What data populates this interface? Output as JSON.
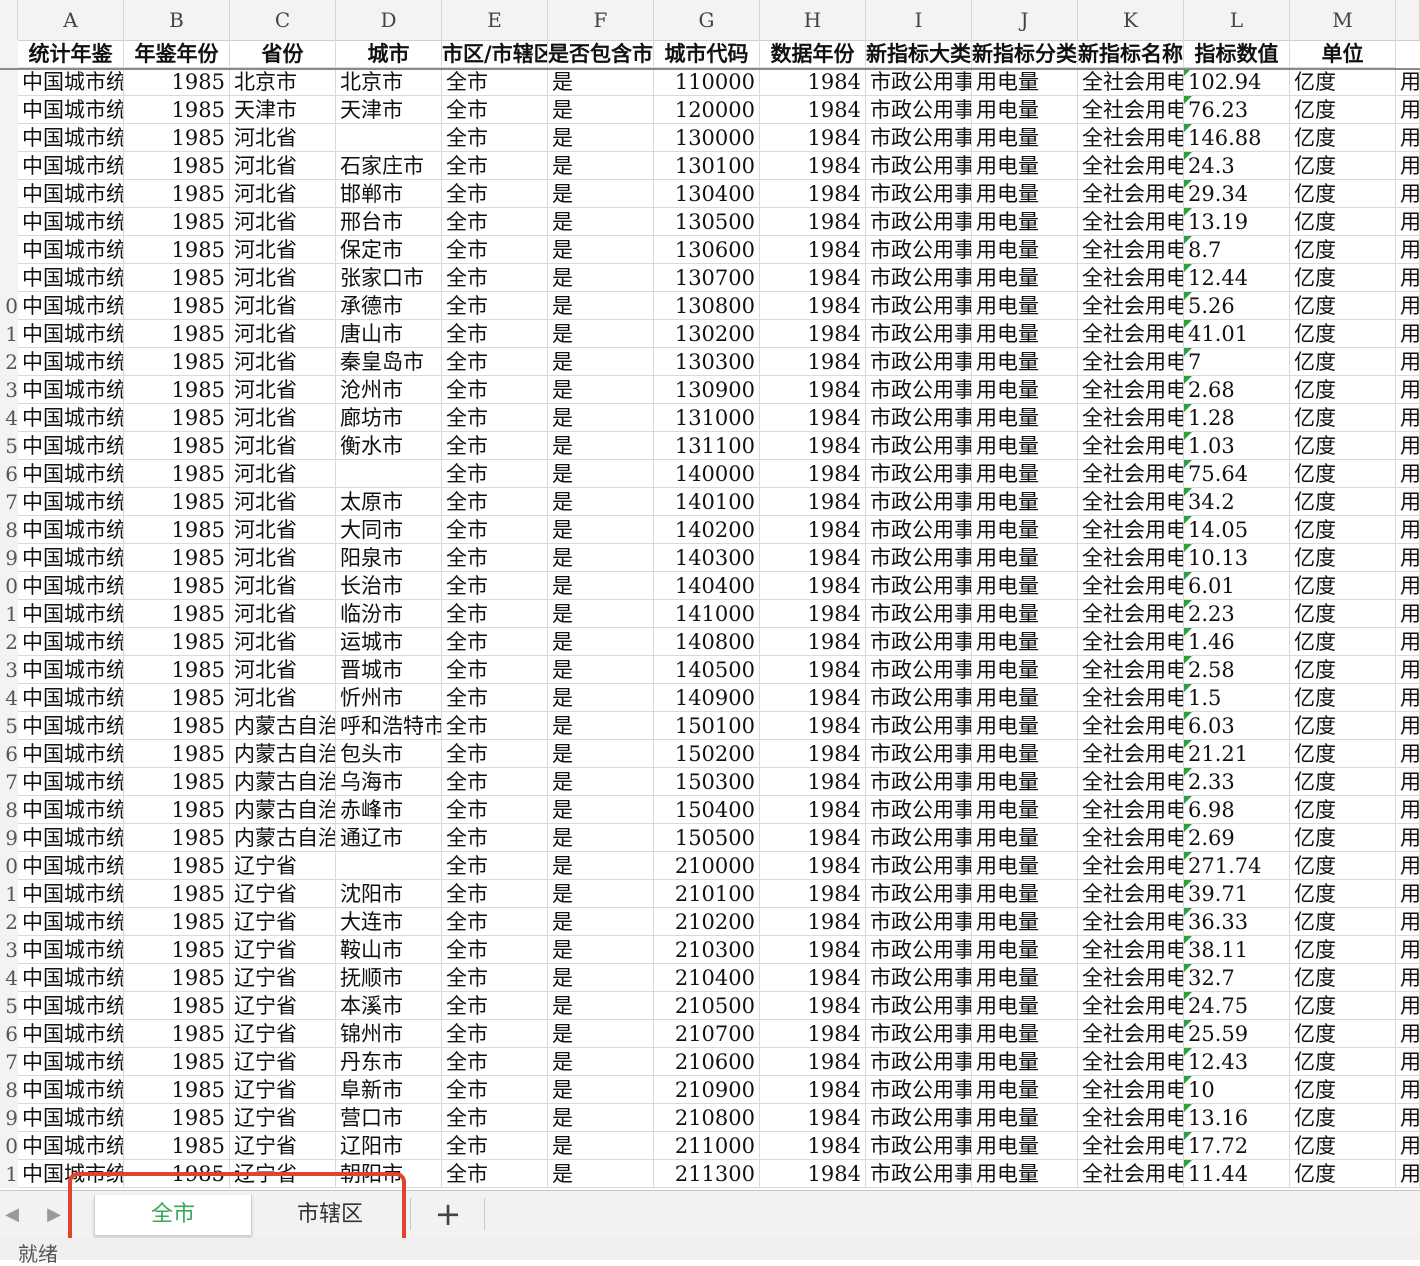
{
  "columns": [
    "A",
    "B",
    "C",
    "D",
    "E",
    "F",
    "G",
    "H",
    "I",
    "J",
    "K",
    "L",
    "M"
  ],
  "header": [
    "统计年鉴",
    "年鉴年份",
    "省份",
    "城市",
    "市区/市辖区",
    "是否包含市辖区",
    "城市代码",
    "数据年份",
    "新指标大类",
    "新指标分类",
    "新指标名称",
    "指标数值",
    "单位"
  ],
  "rows": [
    {
      "n": "",
      "a": "中国城市统",
      "b": "1985",
      "c": "北京市",
      "d": "北京市",
      "e": "全市",
      "f": "是",
      "g": "110000",
      "h": "1984",
      "i": "市政公用事",
      "j": "用电量",
      "k": "全社会用电",
      "l": "102.94",
      "m": "亿度",
      "x": "用"
    },
    {
      "n": "",
      "a": "中国城市统",
      "b": "1985",
      "c": "天津市",
      "d": "天津市",
      "e": "全市",
      "f": "是",
      "g": "120000",
      "h": "1984",
      "i": "市政公用事",
      "j": "用电量",
      "k": "全社会用电",
      "l": "76.23",
      "m": "亿度",
      "x": "用"
    },
    {
      "n": "",
      "a": "中国城市统",
      "b": "1985",
      "c": "河北省",
      "d": "",
      "e": "全市",
      "f": "是",
      "g": "130000",
      "h": "1984",
      "i": "市政公用事",
      "j": "用电量",
      "k": "全社会用电",
      "l": "146.88",
      "m": "亿度",
      "x": "用"
    },
    {
      "n": "",
      "a": "中国城市统",
      "b": "1985",
      "c": "河北省",
      "d": "石家庄市",
      "e": "全市",
      "f": "是",
      "g": "130100",
      "h": "1984",
      "i": "市政公用事",
      "j": "用电量",
      "k": "全社会用电",
      "l": "24.3",
      "m": "亿度",
      "x": "用"
    },
    {
      "n": "",
      "a": "中国城市统",
      "b": "1985",
      "c": "河北省",
      "d": "邯郸市",
      "e": "全市",
      "f": "是",
      "g": "130400",
      "h": "1984",
      "i": "市政公用事",
      "j": "用电量",
      "k": "全社会用电",
      "l": "29.34",
      "m": "亿度",
      "x": "用"
    },
    {
      "n": "",
      "a": "中国城市统",
      "b": "1985",
      "c": "河北省",
      "d": "邢台市",
      "e": "全市",
      "f": "是",
      "g": "130500",
      "h": "1984",
      "i": "市政公用事",
      "j": "用电量",
      "k": "全社会用电",
      "l": "13.19",
      "m": "亿度",
      "x": "用"
    },
    {
      "n": "",
      "a": "中国城市统",
      "b": "1985",
      "c": "河北省",
      "d": "保定市",
      "e": "全市",
      "f": "是",
      "g": "130600",
      "h": "1984",
      "i": "市政公用事",
      "j": "用电量",
      "k": "全社会用电",
      "l": "8.7",
      "m": "亿度",
      "x": "用"
    },
    {
      "n": "",
      "a": "中国城市统",
      "b": "1985",
      "c": "河北省",
      "d": "张家口市",
      "e": "全市",
      "f": "是",
      "g": "130700",
      "h": "1984",
      "i": "市政公用事",
      "j": "用电量",
      "k": "全社会用电",
      "l": "12.44",
      "m": "亿度",
      "x": "用"
    },
    {
      "n": "0",
      "a": "中国城市统",
      "b": "1985",
      "c": "河北省",
      "d": "承德市",
      "e": "全市",
      "f": "是",
      "g": "130800",
      "h": "1984",
      "i": "市政公用事",
      "j": "用电量",
      "k": "全社会用电",
      "l": "5.26",
      "m": "亿度",
      "x": "用"
    },
    {
      "n": "1",
      "a": "中国城市统",
      "b": "1985",
      "c": "河北省",
      "d": "唐山市",
      "e": "全市",
      "f": "是",
      "g": "130200",
      "h": "1984",
      "i": "市政公用事",
      "j": "用电量",
      "k": "全社会用电",
      "l": "41.01",
      "m": "亿度",
      "x": "用"
    },
    {
      "n": "2",
      "a": "中国城市统",
      "b": "1985",
      "c": "河北省",
      "d": "秦皇岛市",
      "e": "全市",
      "f": "是",
      "g": "130300",
      "h": "1984",
      "i": "市政公用事",
      "j": "用电量",
      "k": "全社会用电",
      "l": "7",
      "m": "亿度",
      "x": "用"
    },
    {
      "n": "3",
      "a": "中国城市统",
      "b": "1985",
      "c": "河北省",
      "d": "沧州市",
      "e": "全市",
      "f": "是",
      "g": "130900",
      "h": "1984",
      "i": "市政公用事",
      "j": "用电量",
      "k": "全社会用电",
      "l": "2.68",
      "m": "亿度",
      "x": "用"
    },
    {
      "n": "4",
      "a": "中国城市统",
      "b": "1985",
      "c": "河北省",
      "d": "廊坊市",
      "e": "全市",
      "f": "是",
      "g": "131000",
      "h": "1984",
      "i": "市政公用事",
      "j": "用电量",
      "k": "全社会用电",
      "l": "1.28",
      "m": "亿度",
      "x": "用"
    },
    {
      "n": "5",
      "a": "中国城市统",
      "b": "1985",
      "c": "河北省",
      "d": "衡水市",
      "e": "全市",
      "f": "是",
      "g": "131100",
      "h": "1984",
      "i": "市政公用事",
      "j": "用电量",
      "k": "全社会用电",
      "l": "1.03",
      "m": "亿度",
      "x": "用"
    },
    {
      "n": "6",
      "a": "中国城市统",
      "b": "1985",
      "c": "河北省",
      "d": "",
      "e": "全市",
      "f": "是",
      "g": "140000",
      "h": "1984",
      "i": "市政公用事",
      "j": "用电量",
      "k": "全社会用电",
      "l": "75.64",
      "m": "亿度",
      "x": "用"
    },
    {
      "n": "7",
      "a": "中国城市统",
      "b": "1985",
      "c": "河北省",
      "d": "太原市",
      "e": "全市",
      "f": "是",
      "g": "140100",
      "h": "1984",
      "i": "市政公用事",
      "j": "用电量",
      "k": "全社会用电",
      "l": "34.2",
      "m": "亿度",
      "x": "用"
    },
    {
      "n": "8",
      "a": "中国城市统",
      "b": "1985",
      "c": "河北省",
      "d": "大同市",
      "e": "全市",
      "f": "是",
      "g": "140200",
      "h": "1984",
      "i": "市政公用事",
      "j": "用电量",
      "k": "全社会用电",
      "l": "14.05",
      "m": "亿度",
      "x": "用"
    },
    {
      "n": "9",
      "a": "中国城市统",
      "b": "1985",
      "c": "河北省",
      "d": "阳泉市",
      "e": "全市",
      "f": "是",
      "g": "140300",
      "h": "1984",
      "i": "市政公用事",
      "j": "用电量",
      "k": "全社会用电",
      "l": "10.13",
      "m": "亿度",
      "x": "用"
    },
    {
      "n": "0",
      "a": "中国城市统",
      "b": "1985",
      "c": "河北省",
      "d": "长治市",
      "e": "全市",
      "f": "是",
      "g": "140400",
      "h": "1984",
      "i": "市政公用事",
      "j": "用电量",
      "k": "全社会用电",
      "l": "6.01",
      "m": "亿度",
      "x": "用"
    },
    {
      "n": "1",
      "a": "中国城市统",
      "b": "1985",
      "c": "河北省",
      "d": "临汾市",
      "e": "全市",
      "f": "是",
      "g": "141000",
      "h": "1984",
      "i": "市政公用事",
      "j": "用电量",
      "k": "全社会用电",
      "l": "2.23",
      "m": "亿度",
      "x": "用"
    },
    {
      "n": "2",
      "a": "中国城市统",
      "b": "1985",
      "c": "河北省",
      "d": "运城市",
      "e": "全市",
      "f": "是",
      "g": "140800",
      "h": "1984",
      "i": "市政公用事",
      "j": "用电量",
      "k": "全社会用电",
      "l": "1.46",
      "m": "亿度",
      "x": "用"
    },
    {
      "n": "3",
      "a": "中国城市统",
      "b": "1985",
      "c": "河北省",
      "d": "晋城市",
      "e": "全市",
      "f": "是",
      "g": "140500",
      "h": "1984",
      "i": "市政公用事",
      "j": "用电量",
      "k": "全社会用电",
      "l": "2.58",
      "m": "亿度",
      "x": "用"
    },
    {
      "n": "4",
      "a": "中国城市统",
      "b": "1985",
      "c": "河北省",
      "d": "忻州市",
      "e": "全市",
      "f": "是",
      "g": "140900",
      "h": "1984",
      "i": "市政公用事",
      "j": "用电量",
      "k": "全社会用电",
      "l": "1.5",
      "m": "亿度",
      "x": "用"
    },
    {
      "n": "5",
      "a": "中国城市统",
      "b": "1985",
      "c": "内蒙古自治",
      "d": "呼和浩特市",
      "e": "全市",
      "f": "是",
      "g": "150100",
      "h": "1984",
      "i": "市政公用事",
      "j": "用电量",
      "k": "全社会用电",
      "l": "6.03",
      "m": "亿度",
      "x": "用"
    },
    {
      "n": "6",
      "a": "中国城市统",
      "b": "1985",
      "c": "内蒙古自治",
      "d": "包头市",
      "e": "全市",
      "f": "是",
      "g": "150200",
      "h": "1984",
      "i": "市政公用事",
      "j": "用电量",
      "k": "全社会用电",
      "l": "21.21",
      "m": "亿度",
      "x": "用"
    },
    {
      "n": "7",
      "a": "中国城市统",
      "b": "1985",
      "c": "内蒙古自治",
      "d": "乌海市",
      "e": "全市",
      "f": "是",
      "g": "150300",
      "h": "1984",
      "i": "市政公用事",
      "j": "用电量",
      "k": "全社会用电",
      "l": "2.33",
      "m": "亿度",
      "x": "用"
    },
    {
      "n": "8",
      "a": "中国城市统",
      "b": "1985",
      "c": "内蒙古自治",
      "d": "赤峰市",
      "e": "全市",
      "f": "是",
      "g": "150400",
      "h": "1984",
      "i": "市政公用事",
      "j": "用电量",
      "k": "全社会用电",
      "l": "6.98",
      "m": "亿度",
      "x": "用"
    },
    {
      "n": "9",
      "a": "中国城市统",
      "b": "1985",
      "c": "内蒙古自治",
      "d": "通辽市",
      "e": "全市",
      "f": "是",
      "g": "150500",
      "h": "1984",
      "i": "市政公用事",
      "j": "用电量",
      "k": "全社会用电",
      "l": "2.69",
      "m": "亿度",
      "x": "用"
    },
    {
      "n": "0",
      "a": "中国城市统",
      "b": "1985",
      "c": "辽宁省",
      "d": "",
      "e": "全市",
      "f": "是",
      "g": "210000",
      "h": "1984",
      "i": "市政公用事",
      "j": "用电量",
      "k": "全社会用电",
      "l": "271.74",
      "m": "亿度",
      "x": "用"
    },
    {
      "n": "1",
      "a": "中国城市统",
      "b": "1985",
      "c": "辽宁省",
      "d": "沈阳市",
      "e": "全市",
      "f": "是",
      "g": "210100",
      "h": "1984",
      "i": "市政公用事",
      "j": "用电量",
      "k": "全社会用电",
      "l": "39.71",
      "m": "亿度",
      "x": "用"
    },
    {
      "n": "2",
      "a": "中国城市统",
      "b": "1985",
      "c": "辽宁省",
      "d": "大连市",
      "e": "全市",
      "f": "是",
      "g": "210200",
      "h": "1984",
      "i": "市政公用事",
      "j": "用电量",
      "k": "全社会用电",
      "l": "36.33",
      "m": "亿度",
      "x": "用"
    },
    {
      "n": "3",
      "a": "中国城市统",
      "b": "1985",
      "c": "辽宁省",
      "d": "鞍山市",
      "e": "全市",
      "f": "是",
      "g": "210300",
      "h": "1984",
      "i": "市政公用事",
      "j": "用电量",
      "k": "全社会用电",
      "l": "38.11",
      "m": "亿度",
      "x": "用"
    },
    {
      "n": "4",
      "a": "中国城市统",
      "b": "1985",
      "c": "辽宁省",
      "d": "抚顺市",
      "e": "全市",
      "f": "是",
      "g": "210400",
      "h": "1984",
      "i": "市政公用事",
      "j": "用电量",
      "k": "全社会用电",
      "l": "32.7",
      "m": "亿度",
      "x": "用"
    },
    {
      "n": "5",
      "a": "中国城市统",
      "b": "1985",
      "c": "辽宁省",
      "d": "本溪市",
      "e": "全市",
      "f": "是",
      "g": "210500",
      "h": "1984",
      "i": "市政公用事",
      "j": "用电量",
      "k": "全社会用电",
      "l": "24.75",
      "m": "亿度",
      "x": "用"
    },
    {
      "n": "6",
      "a": "中国城市统",
      "b": "1985",
      "c": "辽宁省",
      "d": "锦州市",
      "e": "全市",
      "f": "是",
      "g": "210700",
      "h": "1984",
      "i": "市政公用事",
      "j": "用电量",
      "k": "全社会用电",
      "l": "25.59",
      "m": "亿度",
      "x": "用"
    },
    {
      "n": "7",
      "a": "中国城市统",
      "b": "1985",
      "c": "辽宁省",
      "d": "丹东市",
      "e": "全市",
      "f": "是",
      "g": "210600",
      "h": "1984",
      "i": "市政公用事",
      "j": "用电量",
      "k": "全社会用电",
      "l": "12.43",
      "m": "亿度",
      "x": "用"
    },
    {
      "n": "8",
      "a": "中国城市统",
      "b": "1985",
      "c": "辽宁省",
      "d": "阜新市",
      "e": "全市",
      "f": "是",
      "g": "210900",
      "h": "1984",
      "i": "市政公用事",
      "j": "用电量",
      "k": "全社会用电",
      "l": "10",
      "m": "亿度",
      "x": "用"
    },
    {
      "n": "9",
      "a": "中国城市统",
      "b": "1985",
      "c": "辽宁省",
      "d": "营口市",
      "e": "全市",
      "f": "是",
      "g": "210800",
      "h": "1984",
      "i": "市政公用事",
      "j": "用电量",
      "k": "全社会用电",
      "l": "13.16",
      "m": "亿度",
      "x": "用"
    },
    {
      "n": "0",
      "a": "中国城市统",
      "b": "1985",
      "c": "辽宁省",
      "d": "辽阳市",
      "e": "全市",
      "f": "是",
      "g": "211000",
      "h": "1984",
      "i": "市政公用事",
      "j": "用电量",
      "k": "全社会用电",
      "l": "17.72",
      "m": "亿度",
      "x": "用"
    },
    {
      "n": "1",
      "a": "中国城市统",
      "b": "1985",
      "c": "辽宁省",
      "d": "朝阳市",
      "e": "全市",
      "f": "是",
      "g": "211300",
      "h": "1984",
      "i": "市政公用事",
      "j": "用电量",
      "k": "全社会用电",
      "l": "11.44",
      "m": "亿度",
      "x": "用"
    }
  ],
  "tabs": [
    {
      "label": "全市",
      "active": true
    },
    {
      "label": "市辖区",
      "active": false
    }
  ],
  "add_tab_label": "+",
  "status_text": "就绪",
  "colors": {
    "accent": "#3aa757",
    "highlight": "#e0442e",
    "error_marker": "#2e9e44"
  }
}
